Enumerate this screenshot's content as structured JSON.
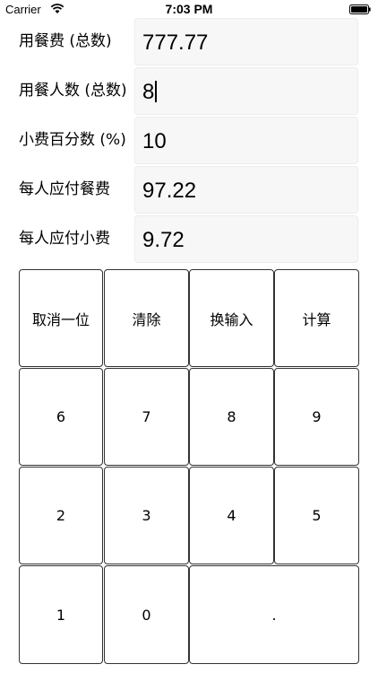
{
  "status_bar": {
    "carrier": "Carrier",
    "time": "7:03 PM",
    "wifi_icon": "wifi-icon",
    "battery_icon": "battery-icon"
  },
  "rows": [
    {
      "label": "用餐费 (总数)",
      "value": "777.77",
      "editable": true,
      "focused": false
    },
    {
      "label": "用餐人数 (总数)",
      "value": "8",
      "editable": true,
      "focused": true
    },
    {
      "label": "小费百分数 (%)",
      "value": "10",
      "editable": true,
      "focused": false
    },
    {
      "label": "每人应付餐费",
      "value": "97.22",
      "editable": false,
      "focused": false
    },
    {
      "label": "每人应付小费",
      "value": "9.72",
      "editable": false,
      "focused": false
    }
  ],
  "keypad": {
    "row1": [
      "取消一位",
      "清除",
      "换输入",
      "计算"
    ],
    "row2": [
      "6",
      "7",
      "8",
      "9"
    ],
    "row3": [
      "2",
      "3",
      "4",
      "5"
    ],
    "row4": [
      "1",
      "0",
      "."
    ]
  }
}
